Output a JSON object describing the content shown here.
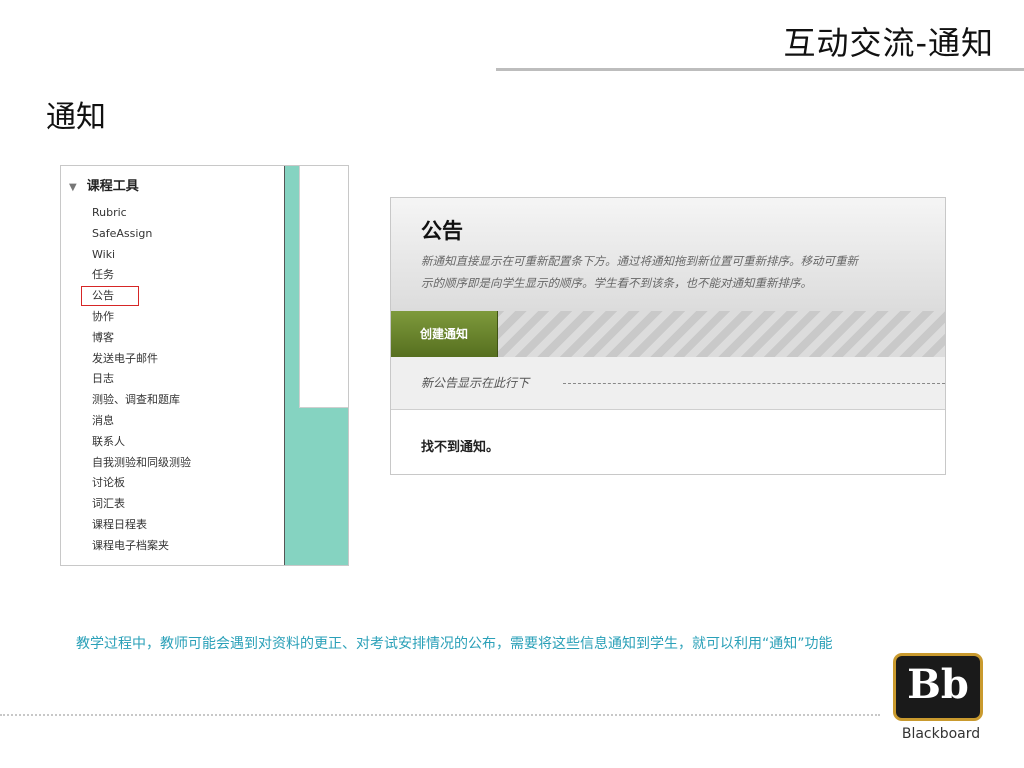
{
  "slide": {
    "title": "互动交流-通知",
    "section_heading": "通知",
    "caption": "教学过程中，教师可能会遇到对资料的更正、对考试安排情况的公布，需要将这些信息通知到学生，就可以利用“通知”功能",
    "brand_text": "Blackboard",
    "logo_text": "Bb"
  },
  "course_tools": {
    "header": "课程工具",
    "items": [
      "Rubric",
      "SafeAssign",
      "Wiki",
      "任务",
      "公告",
      "协作",
      "博客",
      "发送电子邮件",
      "日志",
      "测验、调查和题库",
      "消息",
      "联系人",
      "自我测验和同级测验",
      "讨论板",
      "词汇表",
      "课程日程表",
      "课程电子档案夹"
    ],
    "highlighted_item": "公告"
  },
  "announcements": {
    "title": "公告",
    "description_line1": "新通知直接显示在可重新配置条下方。通过将通知拖到新位置可重新排序。移动可重新",
    "description_line2": "示的顺序即是向学生显示的顺序。学生看不到该条，也不能对通知重新排序。",
    "create_button": "创建通知",
    "marker_text": "新公告显示在此行下",
    "empty_message": "找不到通知。"
  },
  "colors": {
    "teal": "#85d3c1",
    "caption": "#2aa0b8",
    "button_green": "#6b8630",
    "highlight_red": "#d62626"
  }
}
